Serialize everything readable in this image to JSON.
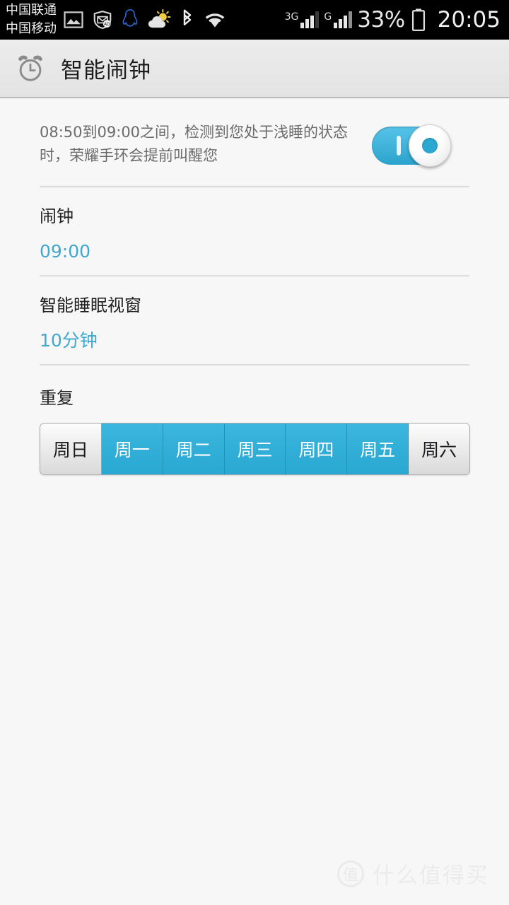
{
  "status_bar": {
    "carrier_line1": "中国联通",
    "carrier_line2": "中国移动",
    "icons": [
      "gallery-icon",
      "mail-shield-ad-icon",
      "qq-penguin-icon",
      "weather-sun-cloud-icon",
      "bluetooth-icon",
      "wifi-icon"
    ],
    "signal_3g_label": "3G",
    "signal_g_label": "G",
    "battery_percent": "33%",
    "clock": "20:05"
  },
  "header": {
    "icon": "alarm-clock-icon",
    "title": "智能闹钟"
  },
  "smart_alarm": {
    "description": "08:50到09:00之间，检测到您处于浅睡的状态时，荣耀手环会提前叫醒您",
    "toggle_state": "on"
  },
  "alarm_field": {
    "label": "闹钟",
    "value": "09:00"
  },
  "sleep_window_field": {
    "label": "智能睡眠视窗",
    "value": "10分钟"
  },
  "repeat": {
    "title": "重复",
    "days": [
      {
        "label": "周日",
        "selected": false
      },
      {
        "label": "周一",
        "selected": true
      },
      {
        "label": "周二",
        "selected": true
      },
      {
        "label": "周三",
        "selected": true
      },
      {
        "label": "周四",
        "selected": true
      },
      {
        "label": "周五",
        "selected": true
      },
      {
        "label": "周六",
        "selected": false
      }
    ]
  },
  "watermark": {
    "logo_text": "值",
    "text": "什么值得买"
  },
  "colors": {
    "accent_blue": "#2ba8d2",
    "value_blue": "#3fa8cc",
    "header_bg": "#e8e8e8",
    "page_bg": "#f7f7f7"
  }
}
